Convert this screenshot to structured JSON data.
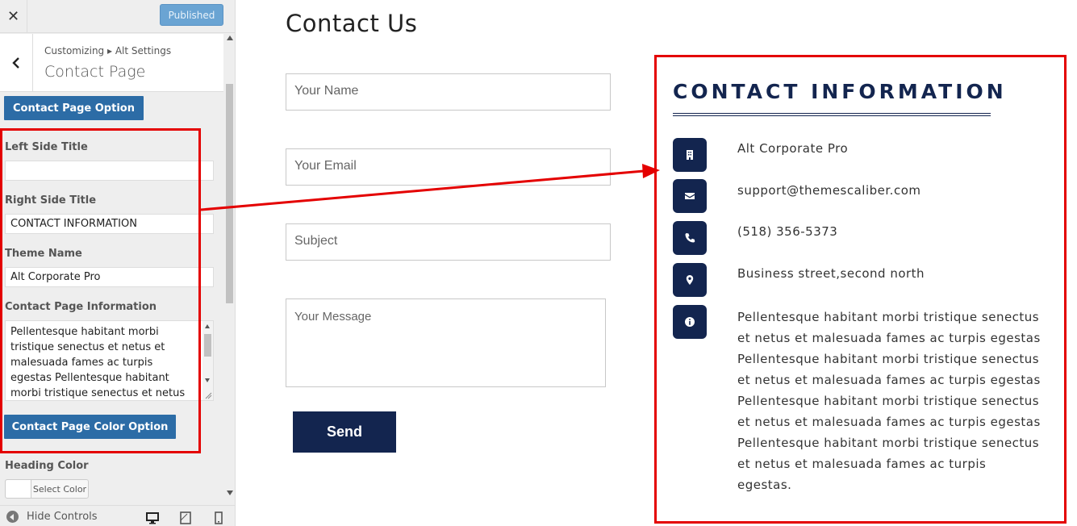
{
  "sidebar": {
    "published_label": "Published",
    "breadcrumb": "Customizing ▸ Alt Settings",
    "section_title": "Contact Page",
    "contact_option_label": "Contact Page Option",
    "left_side_title_label": "Left Side Title",
    "left_side_title_value": "",
    "right_side_title_label": "Right Side Title",
    "right_side_title_value": "CONTACT INFORMATION",
    "theme_name_label": "Theme Name",
    "theme_name_value": "Alt Corporate Pro",
    "contact_info_label": "Contact Page Information",
    "contact_info_value": "Pellentesque habitant morbi tristique senectus et netus et malesuada fames ac turpis egestas Pellentesque habitant morbi tristique senectus et netus et",
    "color_option_label": "Contact Page Color Option",
    "heading_color_label": "Heading Color",
    "select_color_label": "Select Color",
    "hide_controls_label": "Hide Controls"
  },
  "main": {
    "title": "Contact Us",
    "form": {
      "name_placeholder": "Your Name",
      "email_placeholder": "Your Email",
      "subject_placeholder": "Subject",
      "message_placeholder": "Your Message",
      "send_label": "Send"
    },
    "contact_info": {
      "title": "CONTACT INFORMATION",
      "items": [
        {
          "icon": "building-icon",
          "text": "Alt Corporate Pro"
        },
        {
          "icon": "envelope-icon",
          "text": "support@themescaliber.com"
        },
        {
          "icon": "phone-icon",
          "text": "(518) 356-5373"
        },
        {
          "icon": "map-marker-icon",
          "text": "Business street,second north"
        },
        {
          "icon": "info-icon",
          "text": "Pellentesque habitant morbi tristique senectus et netus et malesuada fames ac turpis egestas Pellentesque habitant morbi tristique senectus et netus et malesuada fames ac turpis egestas Pellentesque habitant morbi tristique senectus et netus et malesuada fames ac turpis egestas Pellentesque habitant morbi tristique senectus et netus et malesuada fames ac turpis egestas."
        }
      ]
    }
  },
  "colors": {
    "accent_navy": "#13254f",
    "customizer_blue": "#2c6ca6",
    "highlight_red": "#e40000"
  }
}
